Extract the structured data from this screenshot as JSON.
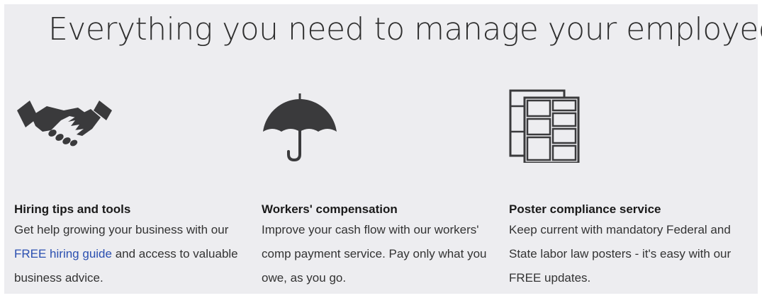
{
  "headline": "Everything you need to manage your employees",
  "features": [
    {
      "icon": "handshake-icon",
      "title": "Hiring tips and tools",
      "desc_pre": "Get help growing your business with our ",
      "link": "FREE hiring guide",
      "desc_post": " and access to valuable business advice."
    },
    {
      "icon": "umbrella-icon",
      "title": "Workers' compensation",
      "desc": "Improve your cash flow with our workers' comp payment service. Pay only what you owe, as you go."
    },
    {
      "icon": "poster-stack-icon",
      "title": "Poster compliance service",
      "desc": "Keep current with mandatory Federal and State labor law posters - it's easy with our FREE updates."
    }
  ],
  "colors": {
    "background": "#ededf0",
    "icon": "#3a3a3c",
    "link": "#2a4fb0"
  }
}
